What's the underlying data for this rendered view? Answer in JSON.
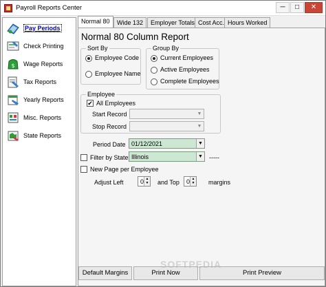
{
  "window": {
    "title": "Payroll Reports Center",
    "min": "─",
    "max": "□",
    "close": "✕"
  },
  "sidebar": {
    "items": [
      {
        "label": "Pay Periods",
        "icon": "pay-periods-icon"
      },
      {
        "label": "Check Printing",
        "icon": "check-printing-icon"
      },
      {
        "label": "Wage Reports",
        "icon": "wage-reports-icon"
      },
      {
        "label": "Tax Reports",
        "icon": "tax-reports-icon"
      },
      {
        "label": "Yearly Reports",
        "icon": "yearly-reports-icon"
      },
      {
        "label": "Misc. Reports",
        "icon": "misc-reports-icon"
      },
      {
        "label": "State Reports",
        "icon": "state-reports-icon"
      }
    ]
  },
  "tabs": [
    {
      "label": "Normal 80"
    },
    {
      "label": "Wide 132"
    },
    {
      "label": "Employer Totals"
    },
    {
      "label": "Cost Acc."
    },
    {
      "label": "Hours Worked"
    }
  ],
  "report": {
    "title": "Normal 80 Column Report",
    "sort_by": {
      "legend": "Sort By",
      "options": [
        "Employee Code",
        "Employee Name"
      ],
      "selected": "Employee Code"
    },
    "group_by": {
      "legend": "Group By",
      "options": [
        "Current Employees",
        "Active Employees",
        "Complete Employees"
      ],
      "selected": "Current Employees"
    },
    "employee": {
      "legend": "Employee",
      "all_employees_label": "All Employees",
      "all_checked": "✔",
      "start_label": "Start Record",
      "stop_label": "Stop Record"
    },
    "period_date": {
      "label": "Period Date",
      "value": "01/12/2021"
    },
    "filter_state": {
      "label": "Filter by State",
      "value": "Illinois",
      "suffix": "-----"
    },
    "new_page_label": "New Page per Employee",
    "adjust": {
      "left_label": "Adjust Left",
      "left_value": "0",
      "top_label": "and Top",
      "top_value": "0",
      "suffix": "margins"
    }
  },
  "buttons": {
    "default_margins": "Default Margins",
    "print_now": "Print Now",
    "print_preview": "Print Preview"
  },
  "watermark": "SOFTPEDIA"
}
